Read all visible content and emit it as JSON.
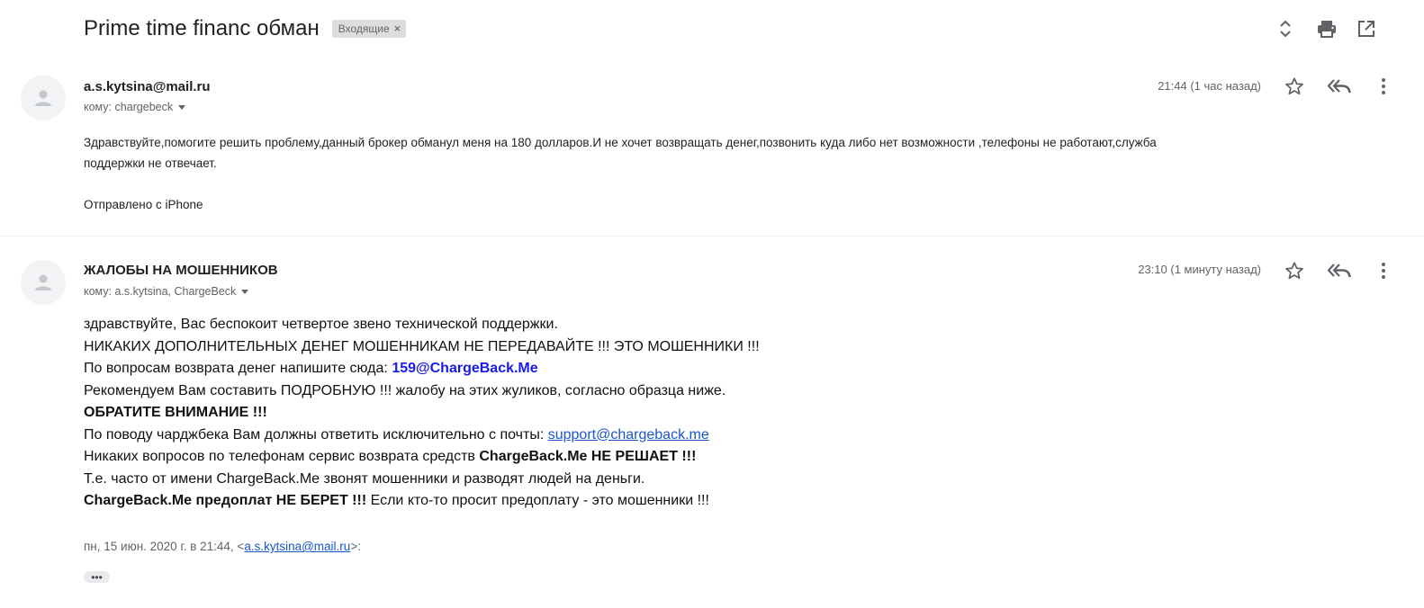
{
  "thread": {
    "subject": "Prime time financ обман",
    "label": "Входящие",
    "label_close": "×"
  },
  "toolbar": {
    "icons": [
      "expand-collapse-icon",
      "print-icon",
      "open-in-new-window-icon"
    ]
  },
  "messages": [
    {
      "sender": "a.s.kytsina@mail.ru",
      "to": "кому: chargebeck",
      "time": "21:44 (1 час назад)",
      "body": {
        "line1": "Здравствуйте,помогите решить проблему,данный брокер обманул меня на 180 долларов.И не хочет возвращать денег,позвонить куда либо нет возможности ,телефоны не работают,служба",
        "line2": "поддержки не отвечает.",
        "signature": "Отправлено с iPhone"
      }
    },
    {
      "sender": "ЖАЛОБЫ НА МОШЕННИКОВ",
      "to": "кому: a.s.kytsina, ChargeBeck",
      "time": "23:10 (1 минуту назад)",
      "body": {
        "l1": "здравствуйте, Вас беспокоит четвертое звено технической поддержки.",
        "l2": "НИКАКИХ ДОПОЛНИТЕЛЬНЫХ ДЕНЕГ МОШЕННИКАМ НЕ ПЕРЕДАВАЙТЕ !!! ЭТО МОШЕННИКИ !!!",
        "l3_prefix": "По вопросам возврата денег напишите сюда: ",
        "l3_link": "159@ChargeBack.Me",
        "l4": "Рекомендуем Вам составить ПОДРОБНУЮ !!! жалобу на этих жуликов, согласно образца ниже.",
        "l5": "ОБРАТИТЕ ВНИМАНИЕ !!!",
        "l6_prefix": "По поводу чарджбека Вам должны ответить исключительно с почты: ",
        "l6_link": "support@chargeback.me",
        "l7_prefix": "Никаких вопросов по телефонам сервис возврата средств ",
        "l7_bold": "ChargeBack.Me НЕ РЕШАЕТ !!!",
        "l8": "Т.е. часто от имени ChargeBack.Me звонят мошенники и разводят людей на деньги.",
        "l9_bold": "ChargeBack.Me предоплат НЕ БЕРЕТ !!!",
        "l9_suffix": " Если кто-то просит предоплату - это мошенники !!!"
      },
      "quote": {
        "prefix": "пн, 15 июн. 2020 г. в 21:44, <",
        "link": "a.s.kytsina@mail.ru",
        "suffix": ">:",
        "toggle": "•••"
      }
    }
  ],
  "colors": {
    "link_bold": "#1a1ae8",
    "link": "#1a57c9",
    "secondary_text": "#5f6368",
    "chip_bg": "#dddddd"
  }
}
